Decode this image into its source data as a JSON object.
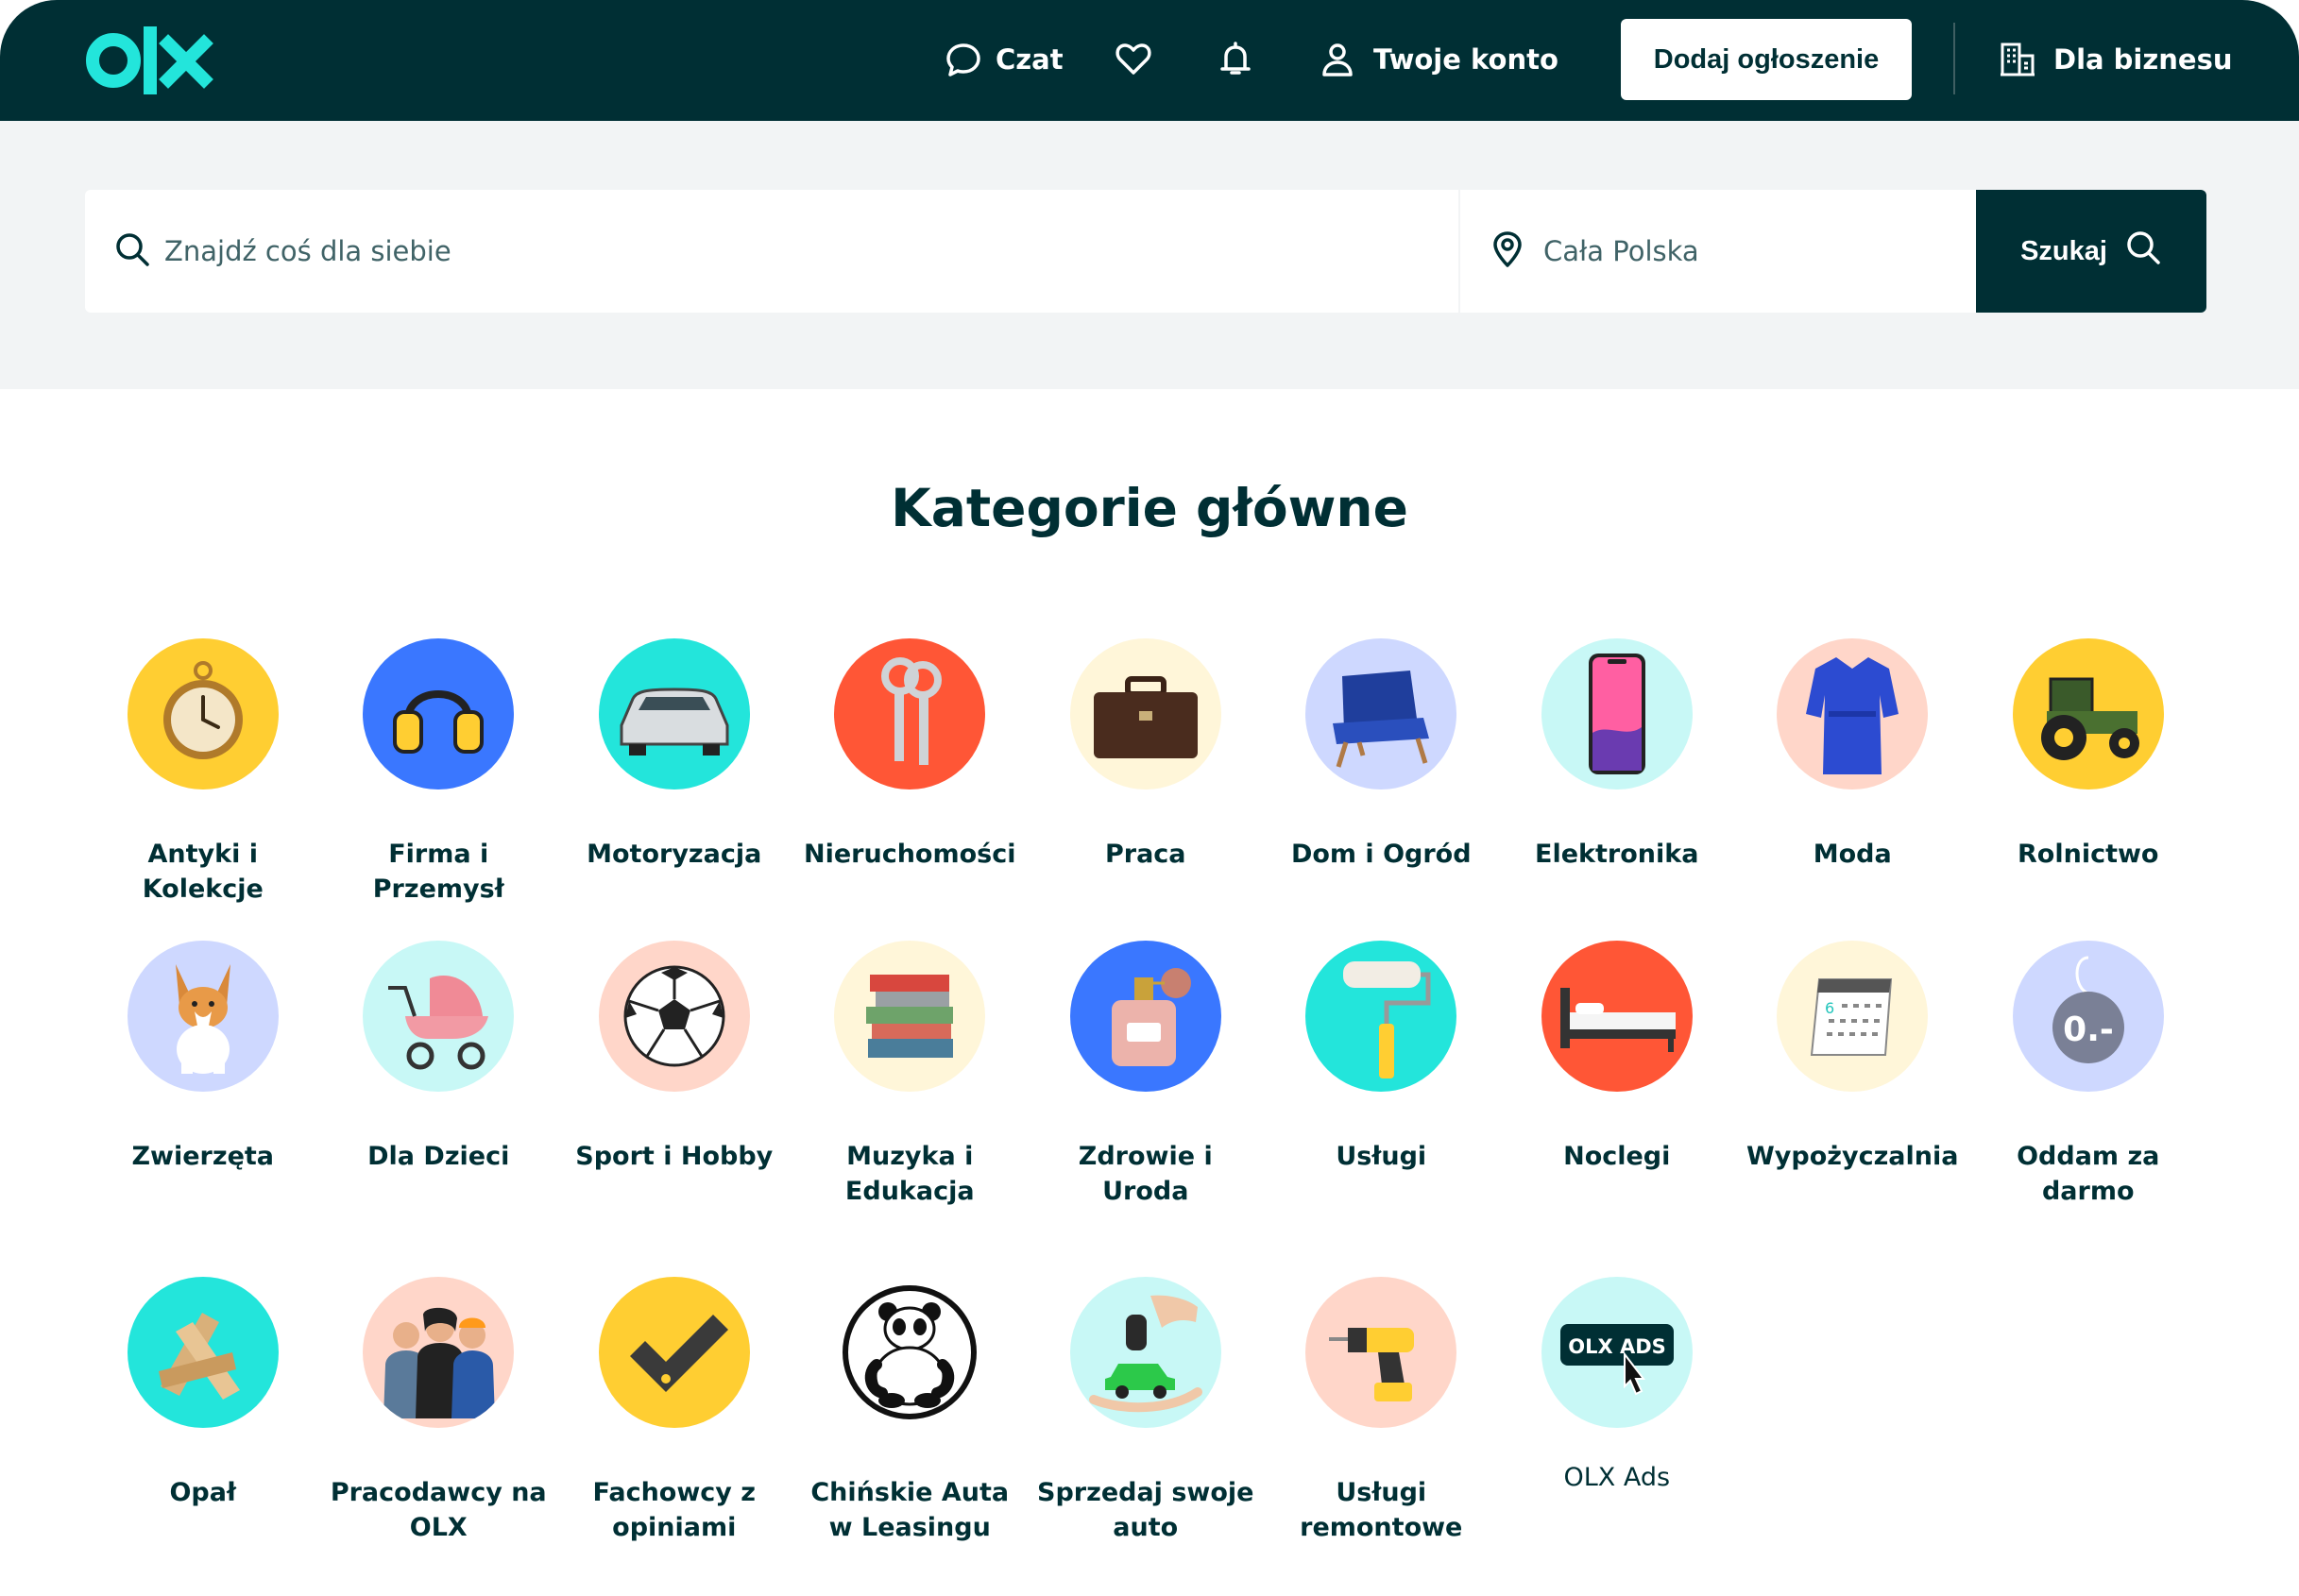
{
  "header": {
    "logo_text": "olx",
    "chat_label": "Czat",
    "account_label": "Twoje konto",
    "add_listing_label": "Dodaj ogłoszenie",
    "business_label": "Dla biznesu"
  },
  "search": {
    "query_placeholder": "Znajdź coś dla siebie",
    "location_placeholder": "Cała Polska",
    "button_label": "Szukaj"
  },
  "categories": {
    "title": "Kategorie główne",
    "items": [
      {
        "label": "Antyki i Kolekcje",
        "icon": "pocket-watch-icon",
        "bg": "#ffce32"
      },
      {
        "label": "Firma i Przemysł",
        "icon": "ear-muffs-icon",
        "bg": "#3a77ff"
      },
      {
        "label": "Motoryzacja",
        "icon": "car-icon",
        "bg": "#23e5db"
      },
      {
        "label": "Nieruchomości",
        "icon": "keys-icon",
        "bg": "#ff5636"
      },
      {
        "label": "Praca",
        "icon": "briefcase-icon",
        "bg": "#fff6d9"
      },
      {
        "label": "Dom i Ogród",
        "icon": "armchair-icon",
        "bg": "#ced8ff"
      },
      {
        "label": "Elektronika",
        "icon": "smartphone-icon",
        "bg": "#c8f8f6"
      },
      {
        "label": "Moda",
        "icon": "robe-icon",
        "bg": "#ffd6c9"
      },
      {
        "label": "Rolnictwo",
        "icon": "tractor-icon",
        "bg": "#ffce32"
      },
      {
        "label": "Zwierzęta",
        "icon": "dog-icon",
        "bg": "#ced8ff"
      },
      {
        "label": "Dla Dzieci",
        "icon": "stroller-icon",
        "bg": "#c8f8f6"
      },
      {
        "label": "Sport i Hobby",
        "icon": "football-icon",
        "bg": "#ffd6c9"
      },
      {
        "label": "Muzyka i Edukacja",
        "icon": "books-icon",
        "bg": "#fff6d9"
      },
      {
        "label": "Zdrowie i Uroda",
        "icon": "perfume-icon",
        "bg": "#3a77ff"
      },
      {
        "label": "Usługi",
        "icon": "paint-roller-icon",
        "bg": "#23e5db"
      },
      {
        "label": "Noclegi",
        "icon": "bed-icon",
        "bg": "#ff5636"
      },
      {
        "label": "Wypożyczalnia",
        "icon": "calendar-icon",
        "bg": "#fff6d9"
      },
      {
        "label": "Oddam za darmo",
        "icon": "free-tag-icon",
        "bg": "#ced8ff"
      },
      {
        "label": "Opał",
        "icon": "firewood-icon",
        "bg": "#23e5db"
      },
      {
        "label": "Pracodawcy na OLX",
        "icon": "employers-icon",
        "bg": "#ffd6c9"
      },
      {
        "label": "Fachowcy z opiniami",
        "icon": "checkmark-icon",
        "bg": "#ffce32"
      },
      {
        "label": "Chińskie Auta w Leasingu",
        "icon": "panda-icon",
        "bg": "#ffffff"
      },
      {
        "label": "Sprzedaj swoje auto",
        "icon": "car-key-icon",
        "bg": "#c8f8f6"
      },
      {
        "label": "Usługi remontowe",
        "icon": "drill-icon",
        "bg": "#ffd6c9"
      },
      {
        "label": "OLX Ads",
        "icon": "olx-ads-icon",
        "bg": "#c8f8f6",
        "badge_text": "OLX ADS"
      }
    ]
  },
  "free_tag_text": "0.-",
  "calendar_day": "6"
}
